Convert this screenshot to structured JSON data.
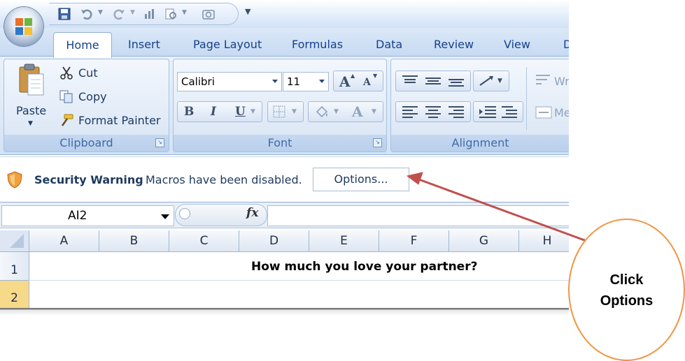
{
  "tabs": [
    "Home",
    "Insert",
    "Page Layout",
    "Formulas",
    "Data",
    "Review",
    "View",
    "D"
  ],
  "clipboard": {
    "paste": "Paste",
    "cut": "Cut",
    "copy": "Copy",
    "format_painter": "Format Painter",
    "label": "Clipboard"
  },
  "font": {
    "name": "Calibri",
    "size": "11",
    "label": "Font",
    "grow": "A",
    "shrink": "A",
    "bold": "B",
    "italic": "I",
    "underline": "U",
    "color": "A"
  },
  "alignment": {
    "label": "Alignment",
    "wrap": "Wr",
    "merge": "Me"
  },
  "message_bar": {
    "title": "Security Warning",
    "text": "Macros have been disabled.",
    "button": "Options..."
  },
  "formula_bar": {
    "name_box": "AI2",
    "fx": "fx",
    "value": ""
  },
  "grid": {
    "columns": [
      "A",
      "B",
      "C",
      "D",
      "E",
      "F",
      "G",
      "H"
    ],
    "rows": [
      "1",
      "2"
    ],
    "selected_row": "2",
    "cell_text": "How much you love your partner?"
  },
  "annotation": {
    "line1": "Click",
    "line2": "Options"
  },
  "colors": {
    "accent": "#15428b",
    "arrow": "#c0504d",
    "callout_border": "#f09543"
  }
}
